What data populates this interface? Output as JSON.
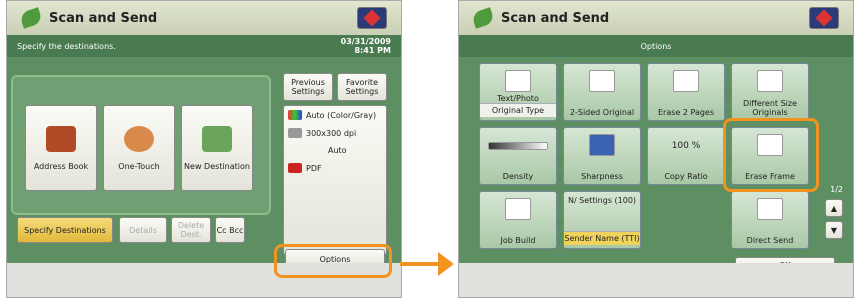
{
  "left": {
    "title": "Scan and Send",
    "status": "Specify the destinations.",
    "date": "03/31/2009",
    "time": "8:41 PM",
    "address_book": "Address Book",
    "one_touch": "One-Touch",
    "new_destination": "New Destination",
    "previous_settings": "Previous Settings",
    "favorite_settings": "Favorite Settings",
    "color_mode": "Auto (Color/Gray)",
    "resolution": "300x300 dpi",
    "size": "Auto",
    "file_format": "PDF",
    "specify_destinations": "Specify Destinations",
    "details": "Details",
    "delete_dest": "Delete Dest.",
    "cc_bcc": "Cc Bcc",
    "options": "Options"
  },
  "right": {
    "title": "Scan and Send",
    "header": "Options",
    "items": [
      {
        "label": "Text/Photo",
        "sub": "Original Type"
      },
      {
        "label": "2-Sided Original",
        "sub": ""
      },
      {
        "label": "Erase 2 Pages",
        "sub": ""
      },
      {
        "label": "Different Size Originals",
        "sub": ""
      },
      {
        "label": "Density",
        "sub": ""
      },
      {
        "label": "Sharpness",
        "sub": ""
      },
      {
        "label": "100 %",
        "sub": "Copy Ratio"
      },
      {
        "label": "Erase Frame",
        "sub": ""
      },
      {
        "label": "Job Build",
        "sub": ""
      },
      {
        "label": "N/ Settings (100)",
        "sub": "Sender Name (TTI)"
      },
      {
        "label": "Direct Send",
        "sub": ""
      }
    ],
    "page_indicator": "1/2",
    "ok": "OK"
  },
  "colors": {
    "accent": "#f2921f",
    "green": "#5e8f63"
  }
}
